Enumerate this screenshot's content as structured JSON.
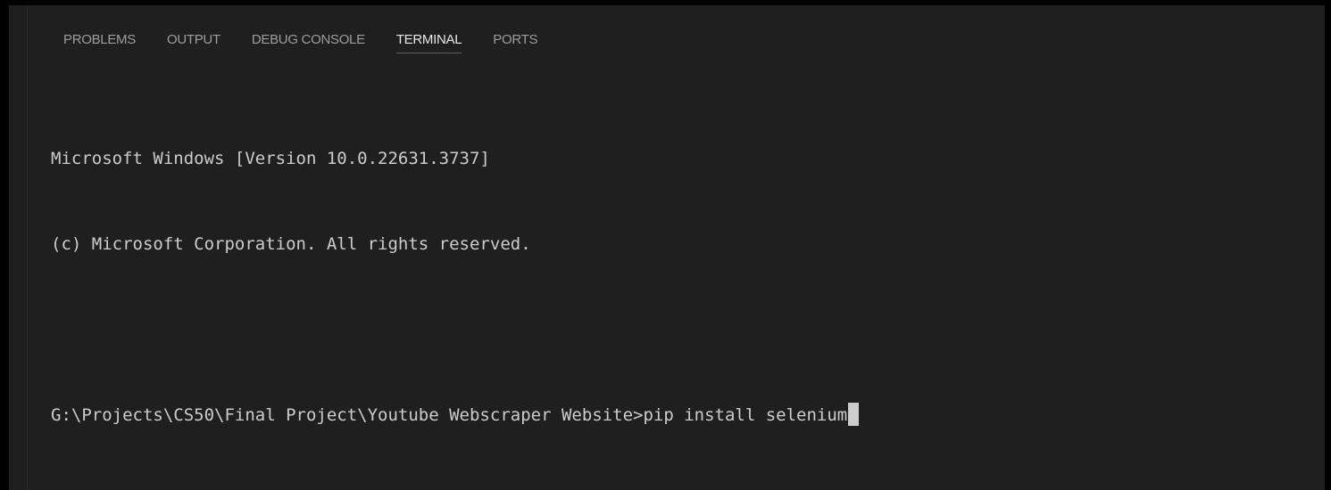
{
  "panel": {
    "tabs": [
      {
        "label": "PROBLEMS"
      },
      {
        "label": "OUTPUT"
      },
      {
        "label": "DEBUG CONSOLE"
      },
      {
        "label": "TERMINAL"
      },
      {
        "label": "PORTS"
      }
    ],
    "active_tab": "TERMINAL"
  },
  "terminal": {
    "lines": [
      "Microsoft Windows [Version 10.0.22631.3737]",
      "(c) Microsoft Corporation. All rights reserved.",
      ""
    ],
    "prompt": "G:\\Projects\\CS50\\Final Project\\Youtube Webscraper Website>",
    "command": "pip install selenium"
  },
  "colors": {
    "background": "#1f1f1f",
    "text": "#cccccc",
    "active_tab_underline": "#0078d4"
  }
}
